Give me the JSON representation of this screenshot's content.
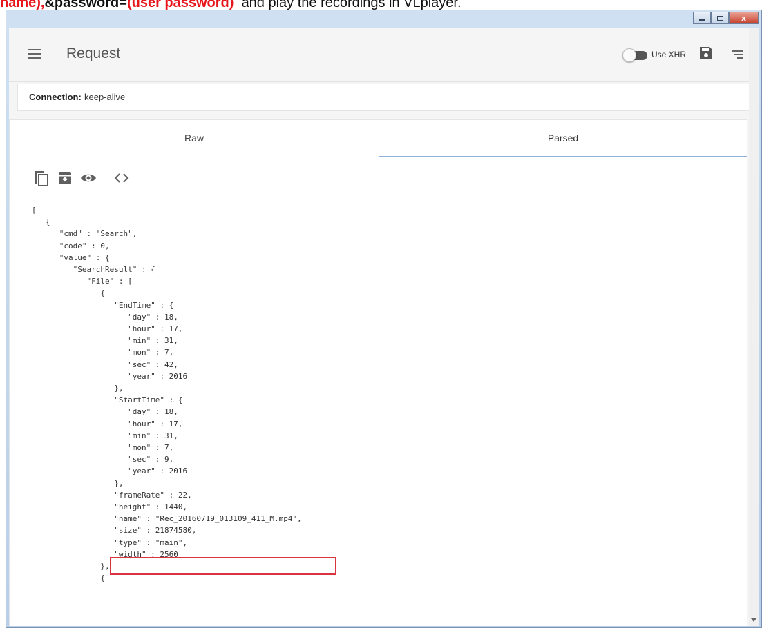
{
  "banner": {
    "part1": "name),",
    "part2": "&password=",
    "part3": "(user password)",
    "part4": "and play the recordings in VLplayer."
  },
  "window": {
    "buttons": {
      "minimize": "",
      "maximize": "",
      "close": "x"
    }
  },
  "appbar": {
    "title": "Request",
    "toggle_label": "Use XHR",
    "toggle_on": false
  },
  "headers": {
    "name": "Connection:",
    "value": "keep-alive"
  },
  "tabs": {
    "raw": "Raw",
    "parsed": "Parsed",
    "selected": "Parsed"
  },
  "toolbar_icons": [
    "copy-icon",
    "archive-icon",
    "eye-icon",
    "code-icon"
  ],
  "code_lines": [
    "[",
    "   {",
    "      \"cmd\" : \"Search\",",
    "      \"code\" : 0,",
    "      \"value\" : {",
    "         \"SearchResult\" : {",
    "            \"File\" : [",
    "               {",
    "                  \"EndTime\" : {",
    "                     \"day\" : 18,",
    "                     \"hour\" : 17,",
    "                     \"min\" : 31,",
    "                     \"mon\" : 7,",
    "                     \"sec\" : 42,",
    "                     \"year\" : 2016",
    "                  },",
    "                  \"StartTime\" : {",
    "                     \"day\" : 18,",
    "                     \"hour\" : 17,",
    "                     \"min\" : 31,",
    "                     \"mon\" : 7,",
    "                     \"sec\" : 9,",
    "                     \"year\" : 2016",
    "                  },",
    "                  \"frameRate\" : 22,",
    "                  \"height\" : 1440,",
    "                  \"name\" : \"Rec_20160719_013109_411_M.mp4\",",
    "                  \"size\" : 21874580,",
    "                  \"type\" : \"main\",",
    "                  \"width\" : 2560",
    "               },",
    "               {"
  ],
  "colors": {
    "highlight": "#d9343f",
    "banner_red": "#e8141c",
    "tab_indicator": "#8fb3dc"
  }
}
